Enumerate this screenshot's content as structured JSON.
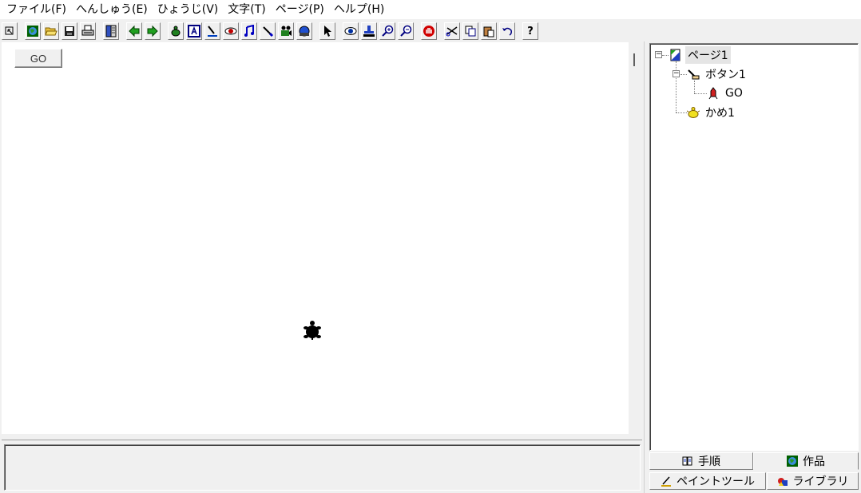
{
  "menu": {
    "items": [
      "ファイル(F)",
      "へんしゅう(E)",
      "ひょうじ(V)",
      "文字(T)",
      "ページ(P)",
      "ヘルプ(H)"
    ]
  },
  "toolbar": {
    "buttons": [
      "pointer-small-icon",
      "globe-icon",
      "open-folder-icon",
      "save-icon",
      "print-icon",
      "book-icon",
      "back-arrow-icon",
      "forward-arrow-icon",
      "turtle-add-icon",
      "text-icon",
      "paint-icon",
      "eye-lens-icon",
      "music-icon",
      "pen-icon",
      "movie-icon",
      "ball-icon",
      "select-arrow-icon",
      "view-icon",
      "stamp-icon",
      "zoom-in-icon",
      "zoom-out-icon",
      "stop-hand-icon",
      "cut-icon",
      "copy-icon",
      "paste-icon",
      "undo-icon",
      "help-icon"
    ],
    "help_label": "?"
  },
  "stage": {
    "go_button_label": "GO"
  },
  "tree": {
    "page_label": "ページ1",
    "button_label": "ボタン1",
    "go_label": "GO",
    "turtle_label": "かめ1",
    "expander_symbol": "⊟"
  },
  "tabs": {
    "procedure": "手順",
    "works": "作品",
    "paint_tool": "ペイントツール",
    "library": "ライブラリ"
  },
  "colors": {
    "face": "#f0f0f0",
    "canvas": "#ffffff",
    "accent_blue": "#0000c0",
    "accent_green": "#008000"
  }
}
